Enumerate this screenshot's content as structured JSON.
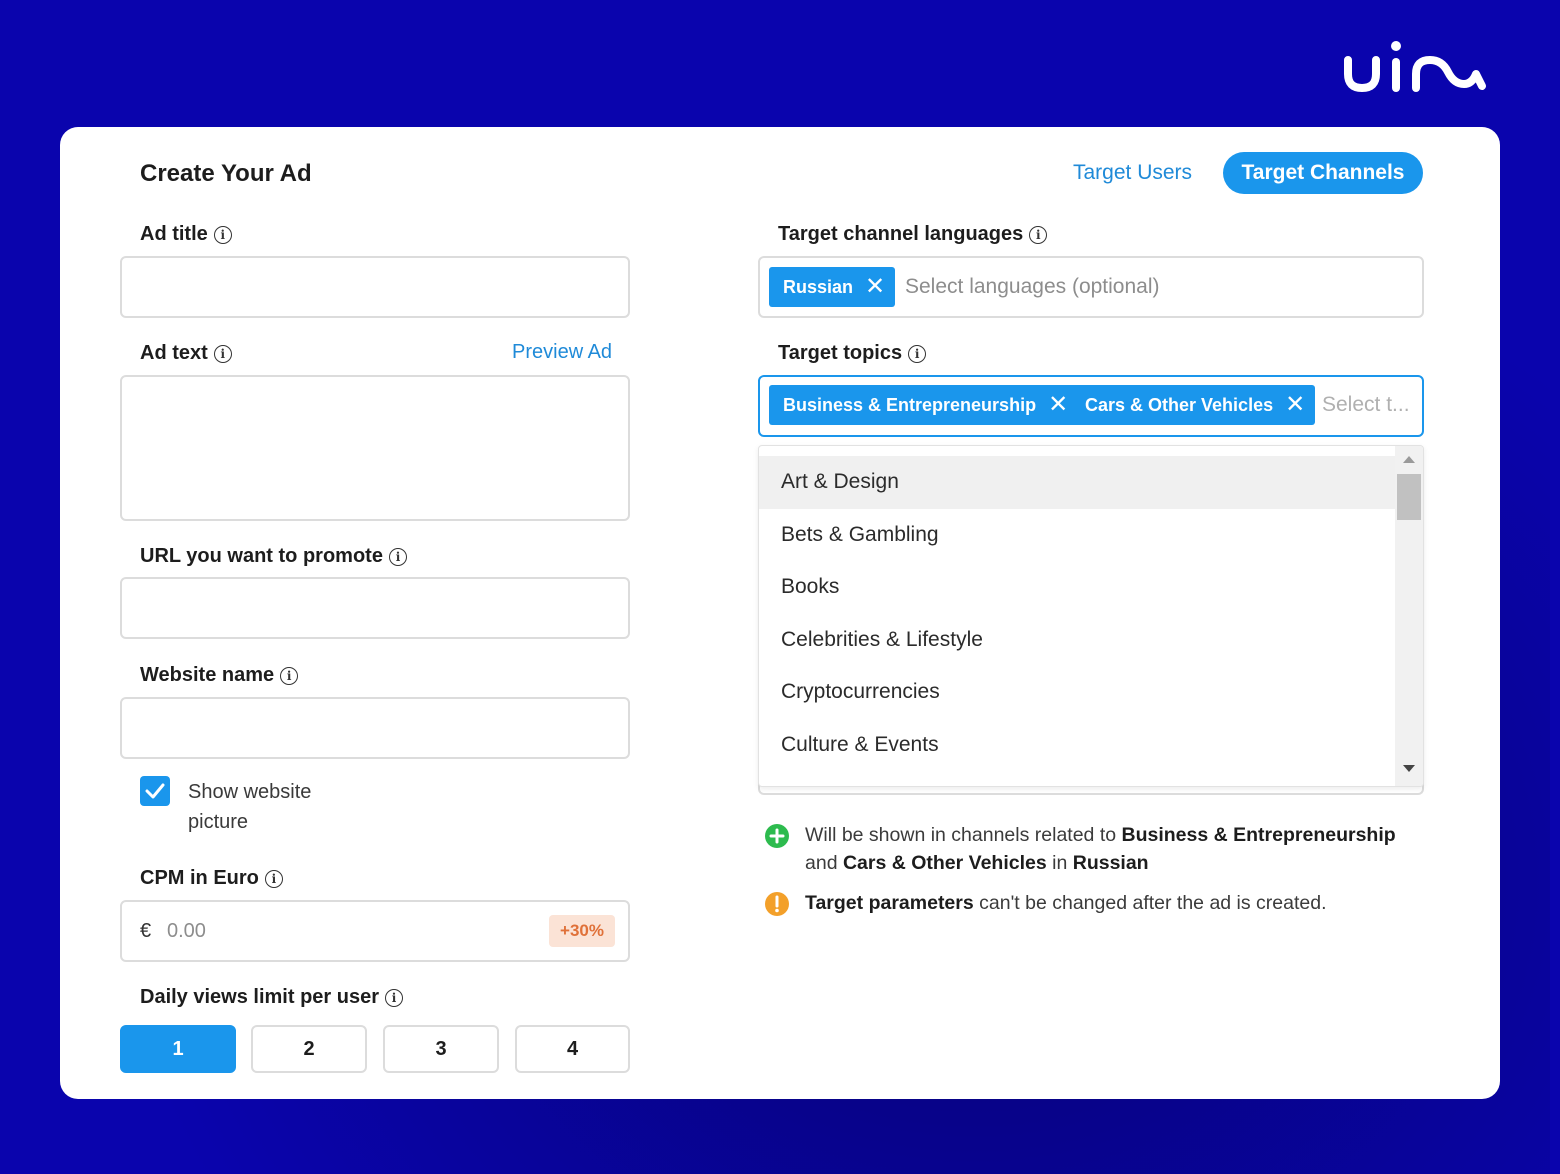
{
  "brand": {
    "logo_text": "uim"
  },
  "page": {
    "title": "Create Your Ad",
    "tabs": [
      {
        "label": "Target Users",
        "active": false
      },
      {
        "label": "Target Channels",
        "active": true
      }
    ]
  },
  "form": {
    "ad_title": {
      "label": "Ad title",
      "value": ""
    },
    "ad_text": {
      "label": "Ad text",
      "value": "",
      "preview_link": "Preview Ad"
    },
    "url": {
      "label": "URL you want to promote",
      "value": ""
    },
    "website_name": {
      "label": "Website name",
      "value": ""
    },
    "show_picture": {
      "label": "Show website picture",
      "line1": "Show website",
      "line2": "picture",
      "checked": true
    },
    "cpm": {
      "label": "CPM in Euro",
      "currency": "€",
      "placeholder": "0.00",
      "badge": "+30%"
    },
    "daily_limit": {
      "label": "Daily views limit per user",
      "options": [
        "1",
        "2",
        "3",
        "4"
      ],
      "selected": "1"
    }
  },
  "targeting": {
    "languages": {
      "label": "Target channel languages",
      "chips": [
        "Russian"
      ],
      "placeholder": "Select languages (optional)"
    },
    "topics": {
      "label": "Target topics",
      "chips": [
        "Business & Entrepreneurship",
        "Cars & Other Vehicles"
      ],
      "placeholder": "Select t...",
      "dropdown_options": [
        "Art & Design",
        "Bets & Gambling",
        "Books",
        "Celebrities & Lifestyle",
        "Cryptocurrencies",
        "Culture & Events"
      ],
      "highlighted_option": "Art & Design"
    },
    "notes": {
      "shown": {
        "p1": "Will be shown in channels related to ",
        "b1": "Business & Entrepreneurship",
        "p2": "and ",
        "b2": "Cars & Other Vehicles",
        "p3": " in ",
        "b3": "Russian"
      },
      "warning": {
        "b1": "Target parameters",
        "p1": " can't be changed after the ad is created."
      }
    }
  },
  "colors": {
    "background": "#0a04ad",
    "accent": "#1a96ec",
    "link": "#1f8ad8",
    "success": "#2dbb4e",
    "warning": "#f3a02a",
    "badge_bg": "#fbe3d6",
    "badge_text": "#e07139"
  },
  "icons": {
    "info": "info-circle-icon",
    "chip_remove": "close-icon",
    "checkbox": "checkmark-icon",
    "success": "plus-circle-icon",
    "warning": "exclamation-circle-icon",
    "scroll_up": "caret-up-icon",
    "scroll_down": "caret-down-icon"
  }
}
